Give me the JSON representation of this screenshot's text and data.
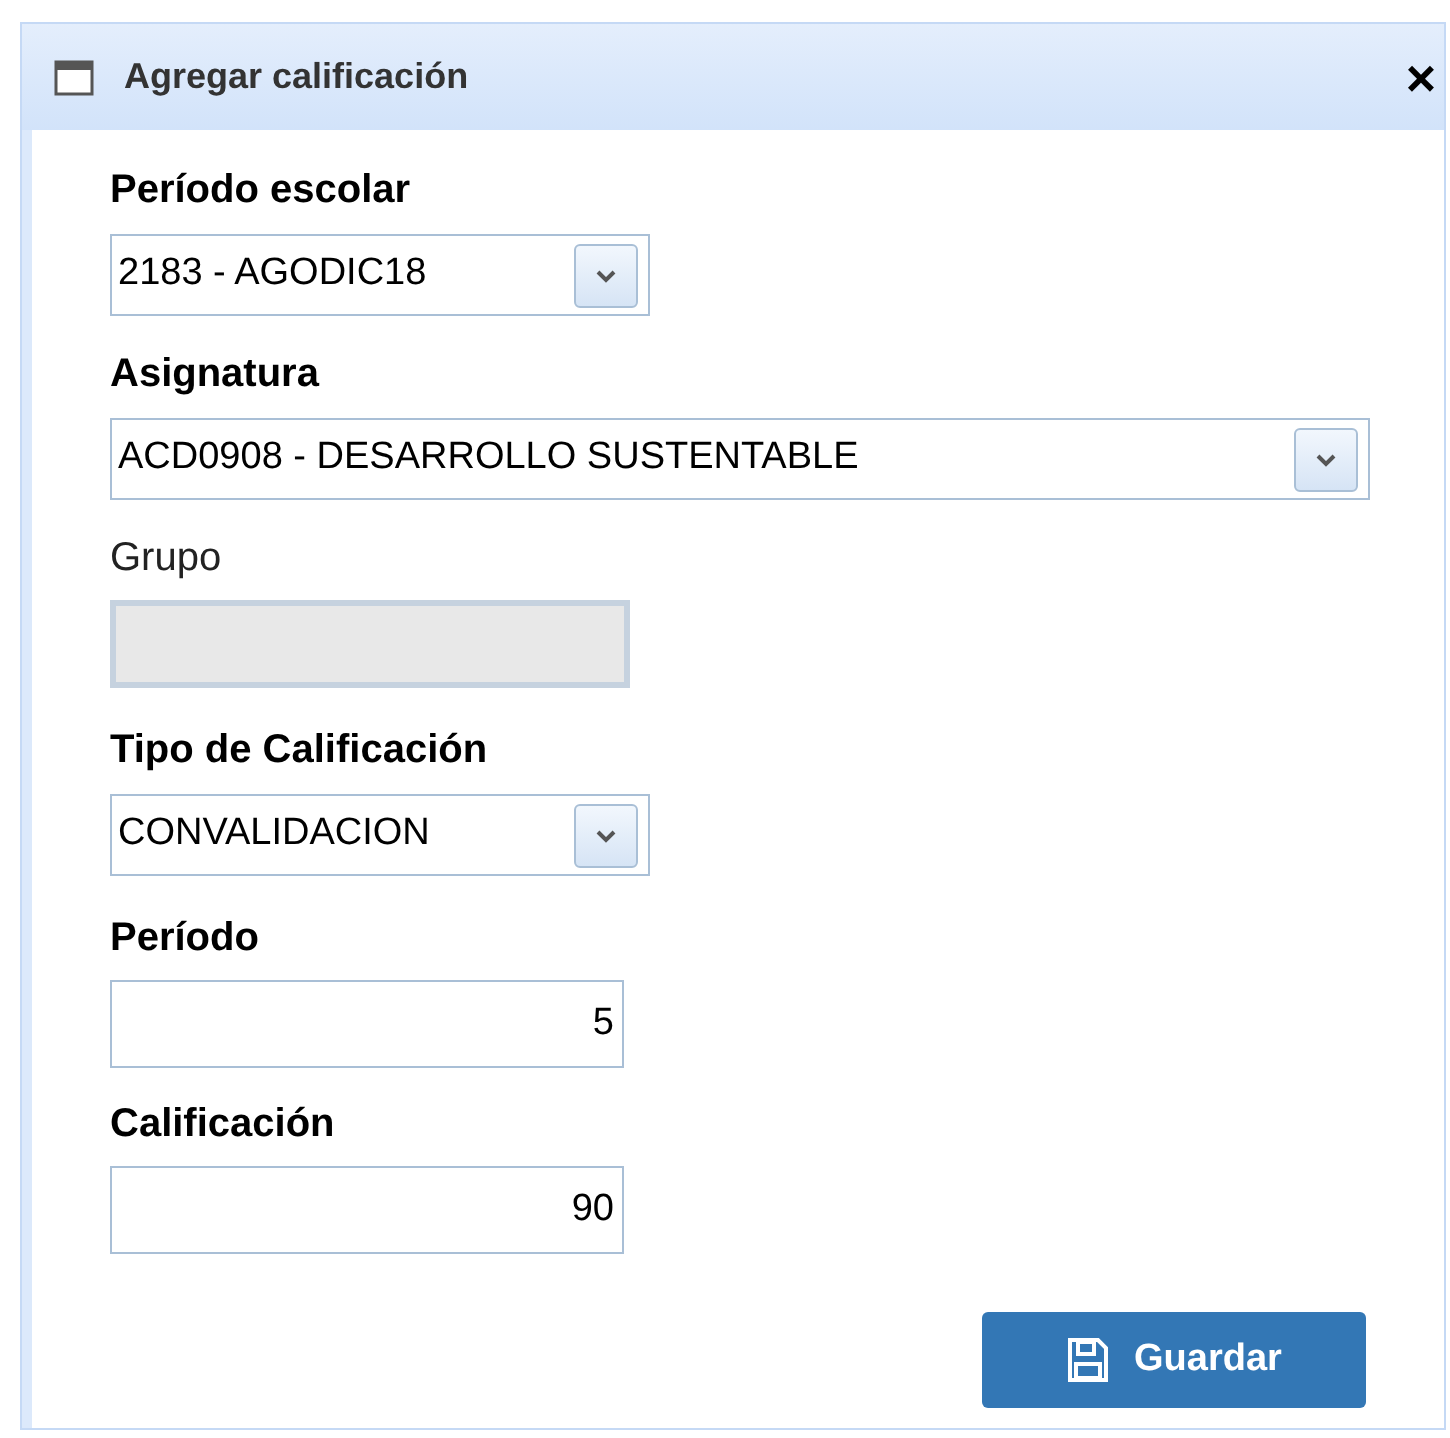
{
  "window": {
    "title": "Agregar calificación",
    "close": "×"
  },
  "fields": [
    {
      "kind": "select",
      "label": "Período escolar",
      "value": "2183 - AGODIC18",
      "disabled": false
    },
    {
      "kind": "select",
      "label": "Asignatura",
      "value": "ACD0908 - DESARROLLO SUSTENTABLE",
      "disabled": false
    },
    {
      "kind": "text",
      "label": "Grupo",
      "disabled": true
    },
    {
      "kind": "select",
      "label": "Tipo de Calificación",
      "value": "CONVALIDACION",
      "disabled": false
    },
    {
      "kind": "number",
      "label": "Período",
      "value": "5",
      "disabled": false
    },
    {
      "kind": "number",
      "label": "Calificación",
      "value": "90",
      "disabled": false
    }
  ],
  "buttons": [
    {
      "label": "Guardar"
    }
  ]
}
